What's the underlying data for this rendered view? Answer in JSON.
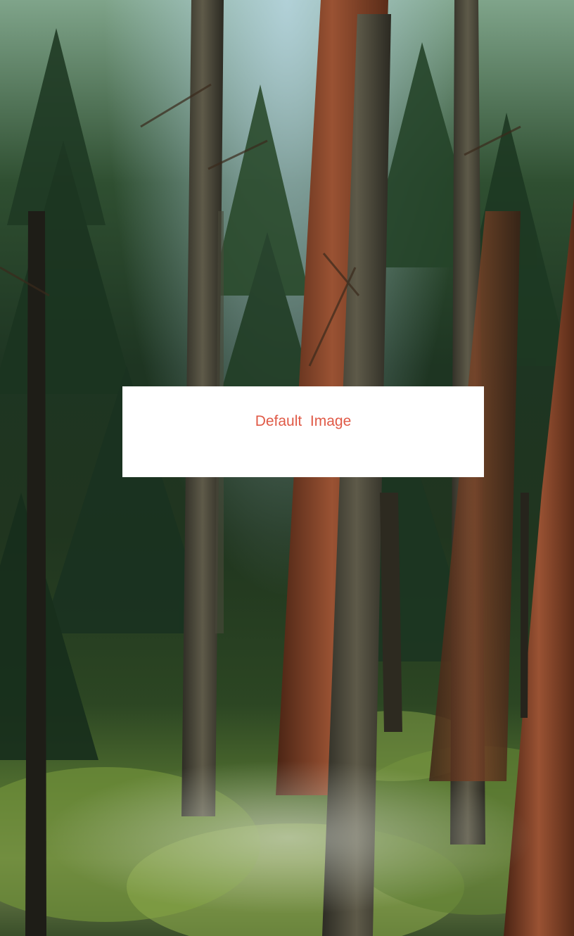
{
  "background": {
    "description_icon": "forest-photo",
    "colors": {
      "sky": "#bfdceb",
      "canopy": "#24402a",
      "trunk_brown": "#6b3a22",
      "trunk_gray": "#4a4a3c",
      "undergrowth": "#8fae4a"
    }
  },
  "placeholder": {
    "label": "Default  Image",
    "label_color": "#e05a47",
    "background_color": "#ffffff"
  }
}
